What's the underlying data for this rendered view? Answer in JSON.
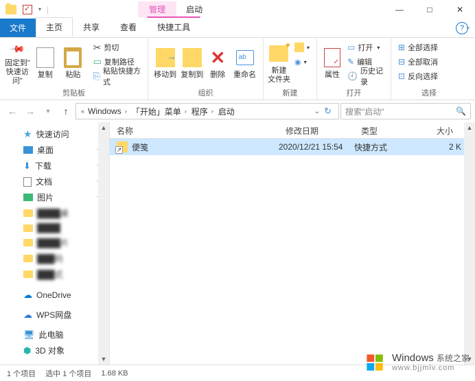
{
  "titlebar": {
    "context_tab": "管理",
    "title": "启动"
  },
  "window_controls": {
    "min": "—",
    "max": "□",
    "close": "✕"
  },
  "tabs": {
    "file": "文件",
    "home": "主页",
    "share": "共享",
    "view": "查看",
    "shortcut_tools": "快捷工具"
  },
  "ribbon": {
    "clipboard": {
      "pin": "固定到\"\n快速访问\"",
      "copy": "复制",
      "paste": "粘贴",
      "cut": "剪切",
      "copy_path": "复制路径",
      "paste_shortcut": "粘贴快捷方式",
      "group": "剪贴板"
    },
    "organize": {
      "move_to": "移动到",
      "copy_to": "复制到",
      "delete": "删除",
      "rename": "重命名",
      "group": "组织"
    },
    "new": {
      "new_folder": "新建\n文件夹",
      "new_item": "新建项目",
      "easy_access": "轻松访问",
      "group": "新建"
    },
    "open": {
      "properties": "属性",
      "open": "打开",
      "edit": "编辑",
      "history": "历史记录",
      "group": "打开"
    },
    "select": {
      "select_all": "全部选择",
      "select_none": "全部取消",
      "invert": "反向选择",
      "group": "选择"
    }
  },
  "breadcrumb": {
    "segs": [
      "Windows",
      "「开始」菜单",
      "程序",
      "启动"
    ]
  },
  "search": {
    "placeholder": "搜索\"启动\""
  },
  "sidebar": {
    "quick_access": "快速访问",
    "desktop": "桌面",
    "downloads": "下载",
    "documents": "文档",
    "pictures": "图片",
    "onedrive": "OneDrive",
    "wps": "WPS网盘",
    "this_pc": "此电脑",
    "objects_3d": "3D 对象"
  },
  "columns": {
    "name": "名称",
    "date": "修改日期",
    "type": "类型",
    "size": "大小"
  },
  "files": [
    {
      "name": "便笺",
      "date": "2020/12/21 15:54",
      "type": "快捷方式",
      "size": "2 K"
    }
  ],
  "status": {
    "count": "1 个项目",
    "selected": "选中 1 个项目",
    "size": "1.68 KB"
  },
  "watermark": {
    "title": "Windows",
    "sub1": "系统之家",
    "sub2": "www.bjjmlv.com"
  }
}
